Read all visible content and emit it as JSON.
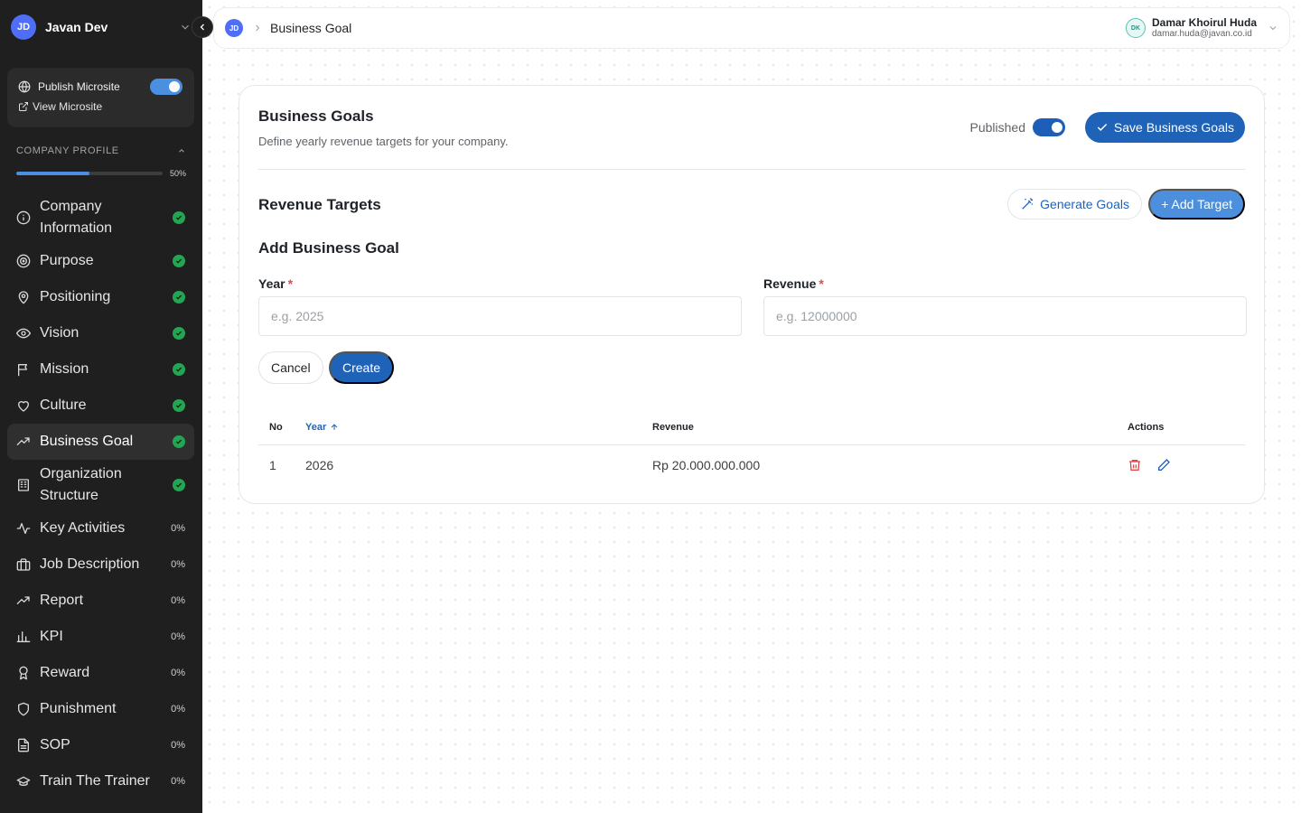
{
  "workspace": {
    "initials": "JD",
    "name": "Javan Dev"
  },
  "publish": {
    "label": "Publish Microsite",
    "view_label": "View Microsite",
    "enabled": true
  },
  "company_profile": {
    "heading": "COMPANY PROFILE",
    "progress_percent": 50,
    "progress_label": "50%"
  },
  "nav": [
    {
      "label": "Company Information",
      "icon": "info-icon",
      "status": "done",
      "pct": ""
    },
    {
      "label": "Purpose",
      "icon": "target-icon",
      "status": "done",
      "pct": ""
    },
    {
      "label": "Positioning",
      "icon": "map-pin-icon",
      "status": "done",
      "pct": ""
    },
    {
      "label": "Vision",
      "icon": "eye-icon",
      "status": "done",
      "pct": ""
    },
    {
      "label": "Mission",
      "icon": "flag-icon",
      "status": "done",
      "pct": ""
    },
    {
      "label": "Culture",
      "icon": "heart-icon",
      "status": "done",
      "pct": ""
    },
    {
      "label": "Business Goal",
      "icon": "trending-up-icon",
      "status": "done",
      "pct": ""
    },
    {
      "label": "Organization Structure",
      "icon": "building-icon",
      "status": "done",
      "pct": ""
    },
    {
      "label": "Key Activities",
      "icon": "activity-icon",
      "status": "pct",
      "pct": "0%"
    },
    {
      "label": "Job Description",
      "icon": "briefcase-icon",
      "status": "pct",
      "pct": "0%"
    },
    {
      "label": "Report",
      "icon": "trending-up-icon",
      "status": "pct",
      "pct": "0%"
    },
    {
      "label": "KPI",
      "icon": "bar-chart-icon",
      "status": "pct",
      "pct": "0%"
    },
    {
      "label": "Reward",
      "icon": "award-icon",
      "status": "pct",
      "pct": "0%"
    },
    {
      "label": "Punishment",
      "icon": "shield-icon",
      "status": "pct",
      "pct": "0%"
    },
    {
      "label": "SOP",
      "icon": "document-icon",
      "status": "pct",
      "pct": "0%"
    },
    {
      "label": "Train The Trainer",
      "icon": "graduation-cap-icon",
      "status": "pct",
      "pct": "0%"
    }
  ],
  "breadcrumb": {
    "initials": "JD",
    "current": "Business Goal"
  },
  "user": {
    "initials": "DK",
    "name": "Damar Khoirul Huda",
    "email": "damar.huda@javan.co.id"
  },
  "card": {
    "title": "Business Goals",
    "description": "Define yearly revenue targets for your company.",
    "published_label": "Published",
    "published": true,
    "save_label": "Save Business Goals",
    "revenue_title": "Revenue Targets",
    "generate_label": "Generate Goals",
    "add_label": "+ Add Target",
    "form_title": "Add Business Goal",
    "year_label": "Year",
    "year_placeholder": "e.g. 2025",
    "revenue_label": "Revenue",
    "revenue_placeholder": "e.g. 12000000",
    "required_mark": "*",
    "cancel_label": "Cancel",
    "create_label": "Create"
  },
  "table": {
    "headers": {
      "no": "No",
      "year": "Year",
      "revenue": "Revenue",
      "actions": "Actions"
    },
    "rows": [
      {
        "no": "1",
        "year": "2026",
        "revenue": "Rp 20.000.000.000"
      }
    ]
  },
  "colors": {
    "sidebar_bg": "#1f1f1f",
    "primary": "#1f63b8",
    "success": "#22a652",
    "danger": "#e5484d"
  }
}
